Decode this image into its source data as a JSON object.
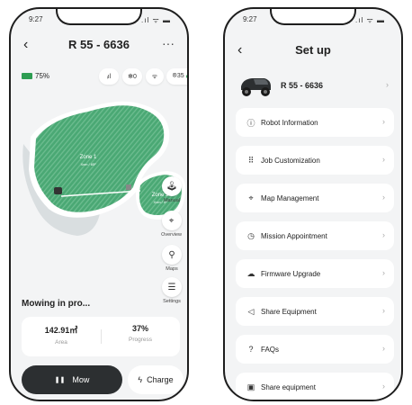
{
  "left": {
    "status_time": "9:27",
    "status_icons": ".ıl ᯤ ▬",
    "title": "R 55 - 6636",
    "back": "‹",
    "more": "···",
    "battery": "75%",
    "chips": {
      "signal": "ᵢıl",
      "bluetooth": "✻0",
      "wifi": "ᯤ",
      "satellites": "ꕕ35"
    },
    "zones": [
      {
        "name": "Zone 1",
        "area": "Xxm / 65²"
      },
      {
        "name": "Zone 2",
        "area": "Xxm / 0²"
      }
    ],
    "side_buttons": [
      "Manual",
      "Overview",
      "Maps",
      "Settings"
    ],
    "mowing_status": "Mowing in pro...",
    "stats": [
      {
        "value": "142.91㎡",
        "label": "Area"
      },
      {
        "value": "37%",
        "label": "Progress"
      }
    ],
    "mow_icon": "❚❚",
    "mow_label": "Mow",
    "charge_icon": "ϟ",
    "charge_label": "Charge"
  },
  "right": {
    "status_time": "9:27",
    "status_icons": ".ıl ᯤ ▬",
    "title": "Set up",
    "back": "‹",
    "device_name": "R 55 - 6636",
    "chevron": "›",
    "menu": [
      {
        "icon": "ⓘ",
        "label": "Robot Information"
      },
      {
        "icon": "⠿",
        "label": "Job Customization"
      },
      {
        "icon": "⌖",
        "label": "Map Management"
      },
      {
        "icon": "◷",
        "label": "Mission Appointment"
      },
      {
        "icon": "☁",
        "label": "Firmware Upgrade"
      },
      {
        "icon": "◁",
        "label": "Share Equipment"
      },
      {
        "icon": "?",
        "label": "FAQs"
      },
      {
        "icon": "▣",
        "label": "Share equipment"
      }
    ]
  },
  "colors": {
    "accent": "#2e9d52",
    "lawn": "#4aa874",
    "dark_button": "#2c2f31"
  }
}
